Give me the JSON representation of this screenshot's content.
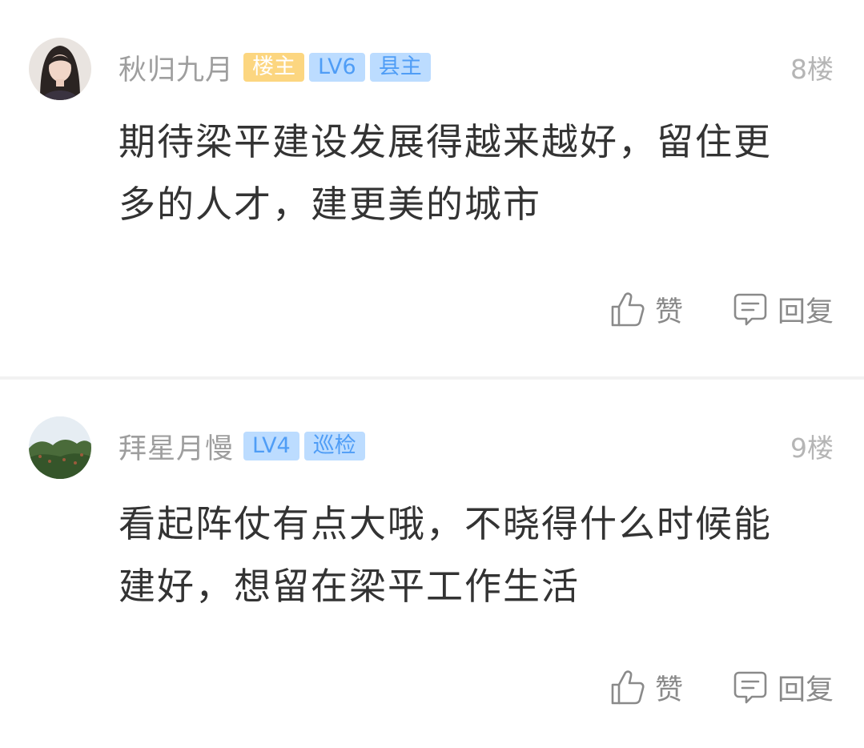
{
  "posts": [
    {
      "username": "秋归九月",
      "badges": [
        "楼主",
        "LV6",
        "县主"
      ],
      "floor": "8楼",
      "content": "期待梁平建设发展得越来越好，留住更多的人才，建更美的城市",
      "like_label": "赞",
      "reply_label": "回复",
      "avatar": "woman-portrait-avatar"
    },
    {
      "username": "拜星月慢",
      "badges": [
        "LV4",
        "巡检"
      ],
      "floor": "9楼",
      "content": "看起阵仗有点大哦，不晓得什么时候能建好，想留在梁平工作生活",
      "like_label": "赞",
      "reply_label": "回复",
      "avatar": "landscape-trees-avatar"
    }
  ],
  "icons": {
    "like": "thumbs-up-icon",
    "reply": "comment-bubble-icon"
  },
  "colors": {
    "owner_badge_bg": "#fcd680",
    "level_badge_bg": "#bcdcff",
    "level_badge_text": "#4f9df6",
    "username": "#9e9e9e",
    "content": "#333333"
  }
}
